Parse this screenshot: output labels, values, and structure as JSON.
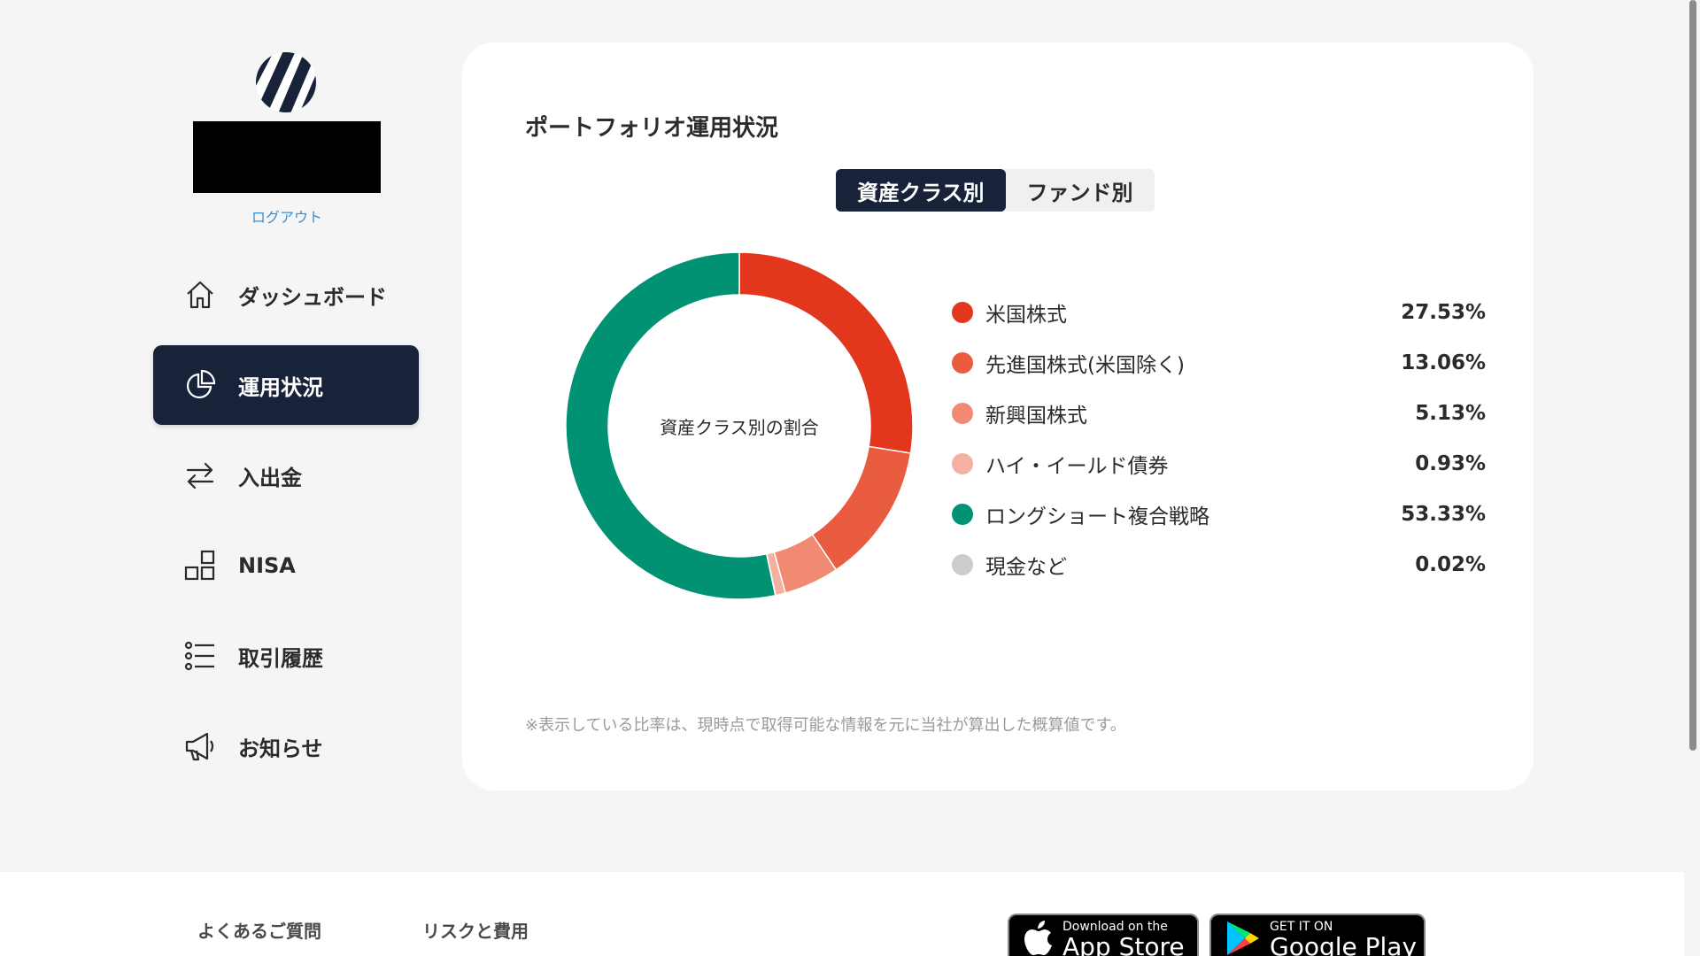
{
  "sidebar": {
    "logout_label": "ログアウト",
    "nav": [
      {
        "label": "ダッシュボード",
        "icon": "home-icon"
      },
      {
        "label": "運用状況",
        "icon": "pie-chart-icon",
        "active": true
      },
      {
        "label": "入出金",
        "icon": "transfer-arrows-icon"
      },
      {
        "label": "NISA",
        "icon": "blocks-icon"
      },
      {
        "label": "取引履歴",
        "icon": "list-icon"
      },
      {
        "label": "お知らせ",
        "icon": "megaphone-icon"
      }
    ]
  },
  "card": {
    "title": "ポートフォリオ運用状況",
    "tabs": [
      {
        "label": "資産クラス別",
        "active": true
      },
      {
        "label": "ファンド別",
        "active": false
      }
    ],
    "donut_center_label": "資産クラス別の割合",
    "note": "※表示している比率は、現時点で取得可能な情報を元に当社が算出した概算値です。"
  },
  "chart_data": {
    "type": "pie",
    "categories": [
      "米国株式",
      "先進国株式(米国除く)",
      "新興国株式",
      "ハイ・イールド債券",
      "ロングショート複合戦略",
      "現金など"
    ],
    "values": [
      27.53,
      13.06,
      5.13,
      0.93,
      53.33,
      0.02
    ],
    "value_labels": [
      "27.53%",
      "13.06%",
      "5.13%",
      "0.93%",
      "53.33%",
      "0.02%"
    ],
    "colors": [
      "#e2371c",
      "#ea5c3f",
      "#f08a73",
      "#f5b0a2",
      "#009272",
      "#cccccc"
    ]
  },
  "footer": {
    "links": [
      "よくあるご質問",
      "リスクと費用"
    ],
    "app_store": {
      "small": "Download on the",
      "big": "App Store"
    },
    "google_play": {
      "small": "GET IT ON",
      "big": "Google Play"
    }
  }
}
